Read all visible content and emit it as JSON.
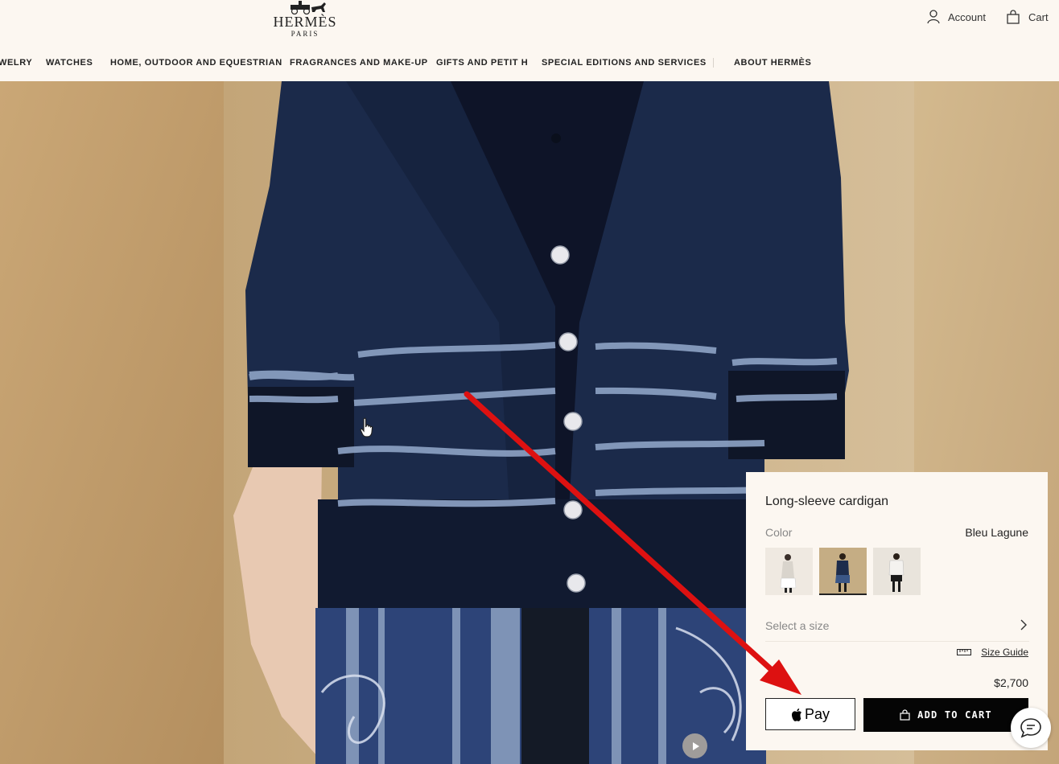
{
  "brand": {
    "name": "HERMÈS",
    "city": "PARIS"
  },
  "header": {
    "account_label": "Account",
    "cart_label": "Cart"
  },
  "nav": {
    "items": [
      "WELRY",
      "WATCHES",
      "HOME, OUTDOOR AND EQUESTRIAN",
      "FRAGRANCES AND MAKE-UP",
      "GIFTS AND PETIT H",
      "SPECIAL EDITIONS AND SERVICES",
      "ABOUT HERMÈS"
    ]
  },
  "product": {
    "title": "Long-sleeve cardigan",
    "color_label": "Color",
    "color_value": "Bleu Lagune",
    "size_placeholder": "Select a size",
    "size_guide": "Size Guide",
    "price": "$2,700",
    "applepay_label": "Pay",
    "add_to_cart": "ADD TO CART",
    "swatches": [
      "white-outfit",
      "navy-outfit",
      "black-white-outfit"
    ],
    "selected_swatch": 1
  },
  "colors": {
    "annotation_arrow": "#dd1111",
    "page_bg": "#fcf7f1",
    "button_bg": "#050505"
  }
}
